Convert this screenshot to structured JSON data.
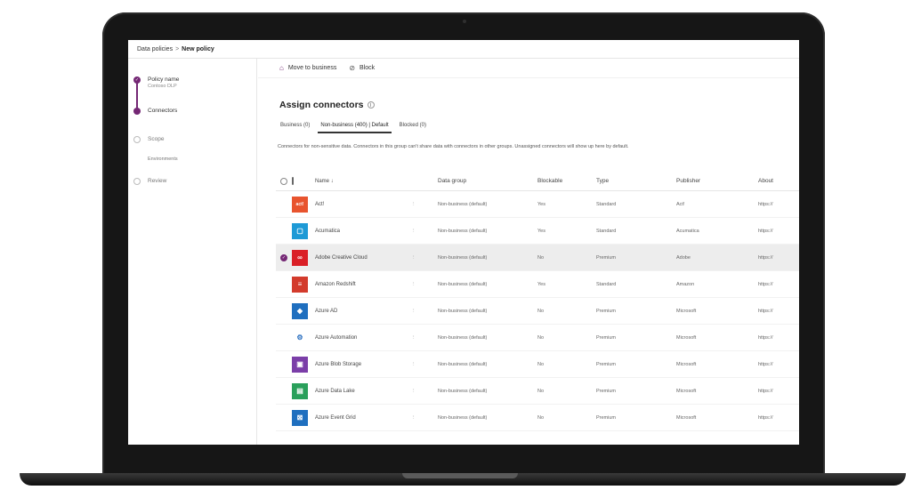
{
  "breadcrumb": {
    "parent": "Data policies",
    "separator": ">",
    "current": "New policy"
  },
  "steps": [
    {
      "label": "Policy name",
      "sub": "Contoso DLP",
      "state": "done"
    },
    {
      "label": "Connectors",
      "sub": "",
      "state": "current"
    },
    {
      "label": "Scope",
      "sub": "",
      "state": "todo"
    },
    {
      "label": "Environments",
      "sub": "",
      "state": "todo"
    },
    {
      "label": "Review",
      "sub": "",
      "state": "todo"
    }
  ],
  "toolbar": {
    "move_label": "Move to business",
    "block_label": "Block"
  },
  "title": "Assign connectors",
  "tabs": [
    {
      "label": "Business (0)",
      "active": false
    },
    {
      "label": "Non-business (400) | Default",
      "active": true
    },
    {
      "label": "Blocked (0)",
      "active": false
    }
  ],
  "description": "Connectors for non-sensitive data. Connectors in this group can't share data with connectors in other groups. Unassigned connectors will show up here by default.",
  "columns": {
    "name": "Name ↓",
    "group": "Data group",
    "blockable": "Blockable",
    "type": "Type",
    "publisher": "Publisher",
    "about": "About"
  },
  "rows": [
    {
      "name": "Act!",
      "group": "Non-business (default)",
      "blockable": "Yes",
      "type": "Standard",
      "publisher": "Act!",
      "about": "https://",
      "color": "#e8542e",
      "glyph": "act!",
      "selected": false
    },
    {
      "name": "Acumatica",
      "group": "Non-business (default)",
      "blockable": "Yes",
      "type": "Standard",
      "publisher": "Acumatica",
      "about": "https://",
      "color": "#1e9ad6",
      "glyph": "▢",
      "selected": false
    },
    {
      "name": "Adobe Creative Cloud",
      "group": "Non-business (default)",
      "blockable": "No",
      "type": "Premium",
      "publisher": "Adobe",
      "about": "https://",
      "color": "#da1f26",
      "glyph": "∞",
      "selected": true
    },
    {
      "name": "Amazon Redshift",
      "group": "Non-business (default)",
      "blockable": "Yes",
      "type": "Standard",
      "publisher": "Amazon",
      "about": "https://",
      "color": "#d33b2c",
      "glyph": "≡",
      "selected": false
    },
    {
      "name": "Azure AD",
      "group": "Non-business (default)",
      "blockable": "No",
      "type": "Premium",
      "publisher": "Microsoft",
      "about": "https://",
      "color": "#1f6fbf",
      "glyph": "◆",
      "selected": false
    },
    {
      "name": "Azure Automation",
      "group": "Non-business (default)",
      "blockable": "No",
      "type": "Premium",
      "publisher": "Microsoft",
      "about": "https://",
      "color": "#ffffff",
      "glyph": "⚙",
      "selected": false
    },
    {
      "name": "Azure Blob Storage",
      "group": "Non-business (default)",
      "blockable": "No",
      "type": "Premium",
      "publisher": "Microsoft",
      "about": "https://",
      "color": "#7b3ea8",
      "glyph": "▣",
      "selected": false
    },
    {
      "name": "Azure Data Lake",
      "group": "Non-business (default)",
      "blockable": "No",
      "type": "Premium",
      "publisher": "Microsoft",
      "about": "https://",
      "color": "#2aa05b",
      "glyph": "▤",
      "selected": false
    },
    {
      "name": "Azure Event Grid",
      "group": "Non-business (default)",
      "blockable": "No",
      "type": "Premium",
      "publisher": "Microsoft",
      "about": "https://",
      "color": "#1f6fbf",
      "glyph": "⊠",
      "selected": false
    }
  ],
  "colors": {
    "accent": "#742774"
  }
}
